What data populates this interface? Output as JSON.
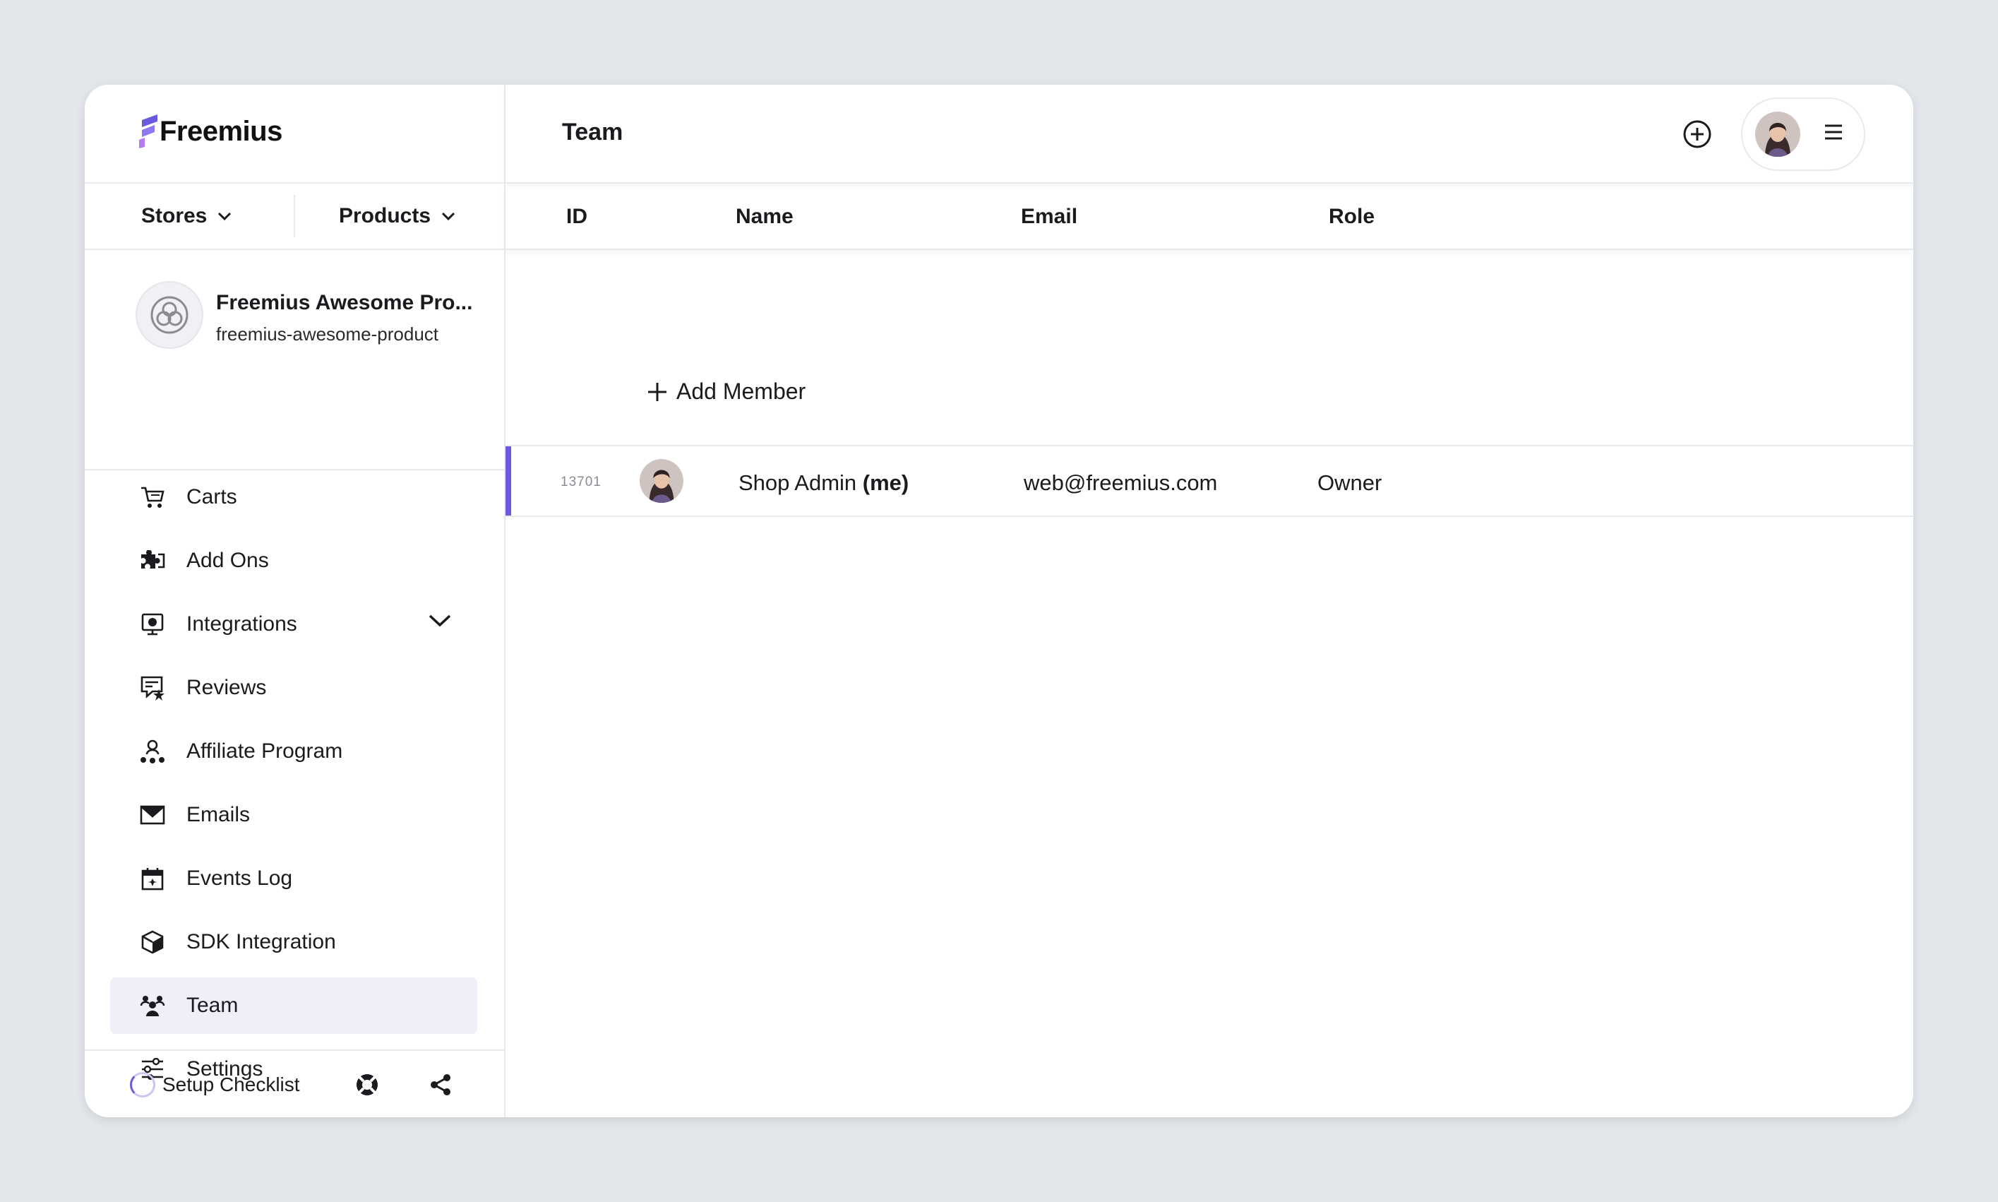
{
  "brand": {
    "name": "Freemius"
  },
  "switcher": {
    "stores_label": "Stores",
    "products_label": "Products"
  },
  "product": {
    "name": "Freemius Awesome Pro...",
    "slug": "freemius-awesome-product"
  },
  "nav": {
    "items": [
      {
        "label": "Carts",
        "icon": "cart-icon"
      },
      {
        "label": "Add Ons",
        "icon": "puzzle-icon"
      },
      {
        "label": "Integrations",
        "icon": "integrations-icon",
        "expandable": true
      },
      {
        "label": "Reviews",
        "icon": "reviews-icon"
      },
      {
        "label": "Affiliate Program",
        "icon": "affiliate-icon"
      },
      {
        "label": "Emails",
        "icon": "envelope-icon"
      },
      {
        "label": "Events Log",
        "icon": "calendar-icon"
      },
      {
        "label": "SDK Integration",
        "icon": "cube-icon"
      },
      {
        "label": "Team",
        "icon": "team-icon",
        "active": true
      },
      {
        "label": "Settings",
        "icon": "sliders-icon"
      }
    ]
  },
  "footer": {
    "setup_label": "Setup Checklist",
    "help_icon": "lifebuoy-icon",
    "share_icon": "share-icon"
  },
  "header": {
    "title": "Team",
    "add_icon": "plus-circle-icon",
    "menu_icon": "hamburger-icon"
  },
  "table": {
    "columns": [
      "ID",
      "Name",
      "Email",
      "Role"
    ],
    "add_label": "Add Member",
    "rows": [
      {
        "id": "13701",
        "name": "Shop Admin",
        "me": "(me)",
        "email": "web@freemius.com",
        "role": "Owner"
      }
    ]
  },
  "colors": {
    "accent": "#6a5ae0",
    "active_bg": "#eeeff9",
    "page_bg": "#e3e6eb"
  }
}
